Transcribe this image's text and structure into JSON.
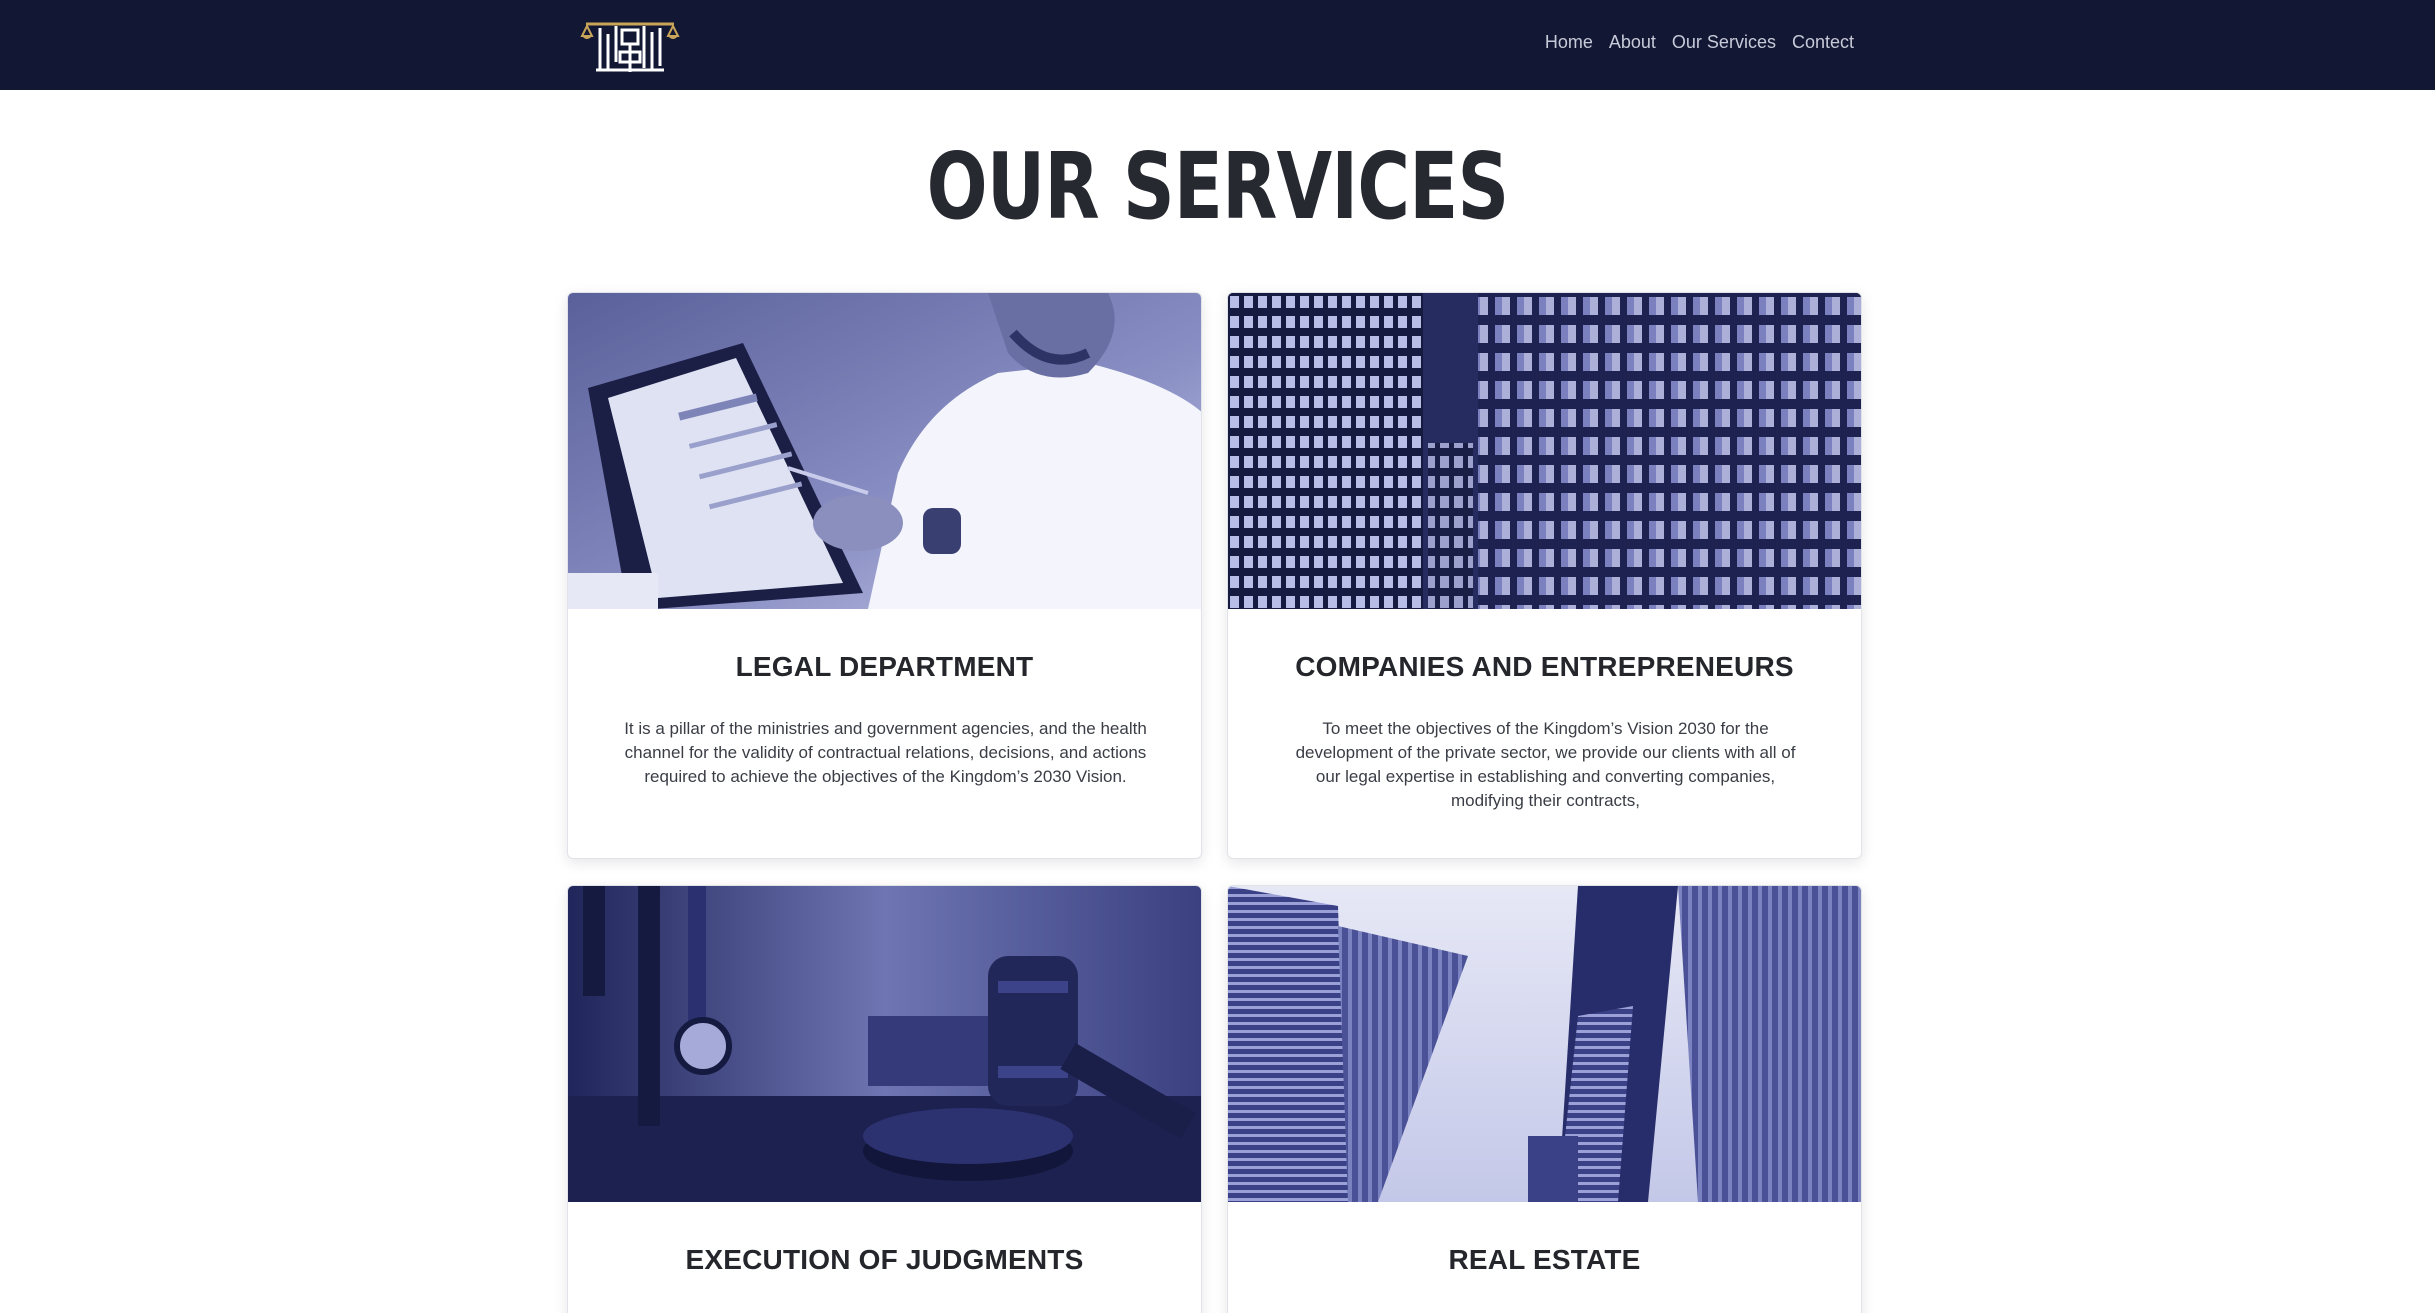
{
  "nav": {
    "items": [
      "Home",
      "About",
      "Our Services",
      "Contect"
    ]
  },
  "page_title": "OUR SERVICES",
  "services": [
    {
      "title": "LEGAL DEPARTMENT",
      "description": "It is a pillar of the ministries and government agencies, and the health channel for the validity of contractual relations, decisions, and actions required to achieve the objectives of the Kingdom’s 2030 Vision."
    },
    {
      "title": "COMPANIES AND ENTREPRENEURS",
      "description": "To meet the objectives of the Kingdom’s Vision 2030 for the development of the private sector, we provide our clients with all of our legal expertise in establishing and converting companies, modifying their contracts,"
    },
    {
      "title": "EXECUTION OF JUDGMENTS",
      "description": ""
    },
    {
      "title": "REAL ESTATE",
      "description": ""
    }
  ],
  "colors": {
    "navbar_bg": "#121733",
    "nav_link": "#c7cad8",
    "logo_gold": "#c9a55a",
    "image_tint": "#2a3170"
  }
}
